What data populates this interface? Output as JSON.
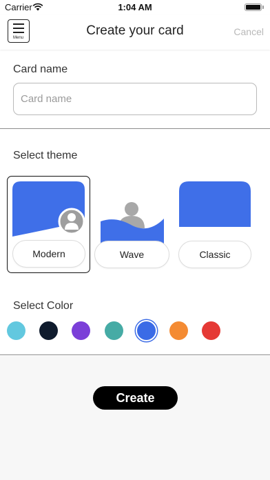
{
  "status_bar": {
    "carrier": "Carrier",
    "time": "1:04 AM",
    "battery_level": 1.0
  },
  "nav": {
    "menu_label": "Menu",
    "title": "Create your card",
    "cancel_label": "Cancel",
    "menu_icon": "hamburger-icon"
  },
  "card_name": {
    "label": "Card name",
    "placeholder": "Card name",
    "value": ""
  },
  "theme": {
    "label": "Select theme",
    "options": [
      {
        "label": "Modern",
        "selected": true
      },
      {
        "label": "Wave",
        "selected": false
      },
      {
        "label": "Classic",
        "selected": false
      }
    ],
    "accent": "#3f6fe8"
  },
  "color": {
    "label": "Select Color",
    "swatches": [
      {
        "hex": "#62c8df",
        "selected": false
      },
      {
        "hex": "#0f1b2d",
        "selected": false
      },
      {
        "hex": "#7b3fd8",
        "selected": false
      },
      {
        "hex": "#46aba5",
        "selected": false
      },
      {
        "hex": "#3b6be6",
        "selected": true
      },
      {
        "hex": "#f48b33",
        "selected": false
      },
      {
        "hex": "#e53935",
        "selected": false
      }
    ]
  },
  "create_label": "Create"
}
